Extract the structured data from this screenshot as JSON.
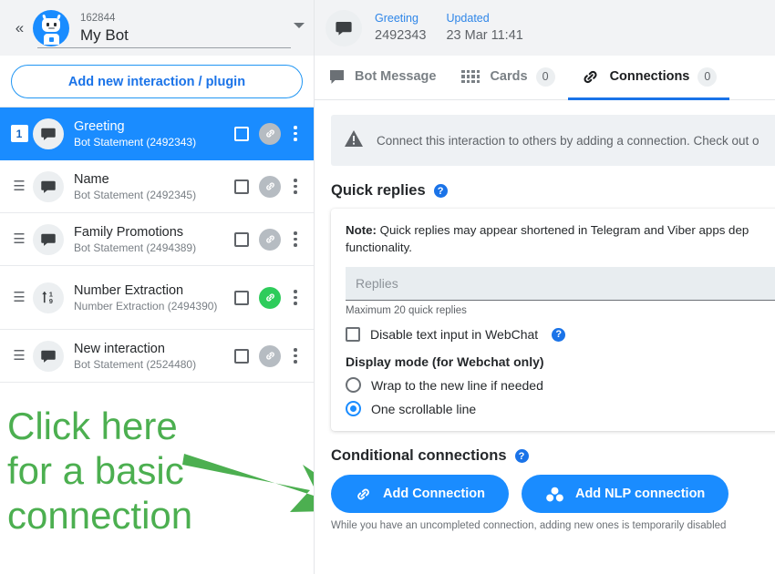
{
  "sidebar": {
    "collapse_icon": "double-chevron-left-icon",
    "bot_id": "162844",
    "bot_name": "My Bot",
    "bot_avatar_icon": "robot-avatar-icon",
    "dropdown_icon": "chevron-down-icon",
    "add_button_label": "Add new interaction / plugin",
    "interactions": [
      {
        "badge": "1",
        "handle_icon": "drag-handle-icon",
        "type_icon": "chat-bubble-icon",
        "title": "Greeting",
        "subtitle": "Bot Statement (2492343)",
        "selected": true,
        "link_active": false,
        "checked": false
      },
      {
        "badge": "=",
        "handle_icon": "drag-handle-icon",
        "type_icon": "chat-bubble-icon",
        "title": "Name",
        "subtitle": "Bot Statement (2492345)",
        "selected": false,
        "link_active": false,
        "checked": false
      },
      {
        "badge": "=",
        "handle_icon": "drag-handle-icon",
        "type_icon": "chat-bubble-icon",
        "title": "Family Promotions",
        "subtitle": "Bot Statement (2494389)",
        "selected": false,
        "link_active": false,
        "checked": false
      },
      {
        "badge": "=",
        "handle_icon": "drag-handle-icon",
        "type_icon": "number-extraction-icon",
        "title": "Number Extraction",
        "subtitle": "Number Extraction (2494390)",
        "selected": false,
        "link_active": true,
        "checked": false
      },
      {
        "badge": "=",
        "handle_icon": "drag-handle-icon",
        "type_icon": "chat-bubble-icon",
        "title": "New interaction",
        "subtitle": "Bot Statement (2524480)",
        "selected": false,
        "link_active": false,
        "checked": false
      }
    ],
    "annotation": {
      "text": "Click here\nfor a basic\nconnection",
      "color": "#4caf50",
      "arrow_icon": "green-arrow-icon"
    }
  },
  "interaction_header": {
    "icon": "chat-bubble-icon",
    "name_label": "Greeting",
    "name_value": "2492343",
    "updated_label": "Updated",
    "updated_value": "23 Mar 11:41"
  },
  "tabs": [
    {
      "id": "bot-message",
      "label": "Bot Message",
      "icon": "chat-bubble-solid-icon",
      "count": null,
      "active": false
    },
    {
      "id": "cards",
      "label": "Cards",
      "icon": "grid-dots-icon",
      "count": "0",
      "active": false
    },
    {
      "id": "connections",
      "label": "Connections",
      "icon": "link-chain-icon",
      "count": "0",
      "active": true
    }
  ],
  "alert": {
    "icon": "warning-triangle-icon",
    "text": "Connect this interaction to others by adding a connection. Check out o"
  },
  "quick_replies": {
    "title": "Quick replies",
    "help_icon": "question-mark-icon",
    "note_label": "Note:",
    "note_text": " Quick replies may appear shortened in Telegram and Viber apps dep",
    "note_text_line2": "functionality.",
    "input_placeholder": "Replies",
    "input_value": "",
    "hint": "Maximum 20 quick replies",
    "disable_text_input_label": "Disable text input in WebChat",
    "disable_text_input_checked": false,
    "display_mode_label": "Display mode (for Webchat only)",
    "options": [
      {
        "label": "Wrap to the new line if needed",
        "selected": false
      },
      {
        "label": "One scrollable line",
        "selected": true
      }
    ]
  },
  "conditional_connections": {
    "title": "Conditional connections",
    "help_icon": "question-mark-icon",
    "add_connection_label": "Add Connection",
    "add_connection_icon": "link-chain-icon",
    "add_nlp_label": "Add NLP connection",
    "add_nlp_icon": "molecule-icon",
    "disclaimer": "While you have an uncompleted connection, adding new ones is temporarily disabled"
  },
  "colors": {
    "accent_blue": "#1a8cff",
    "link_blue": "#1a73e8",
    "green": "#4caf50",
    "link_active_green": "#2ecc5b",
    "header_bg": "#f2f3f5"
  }
}
